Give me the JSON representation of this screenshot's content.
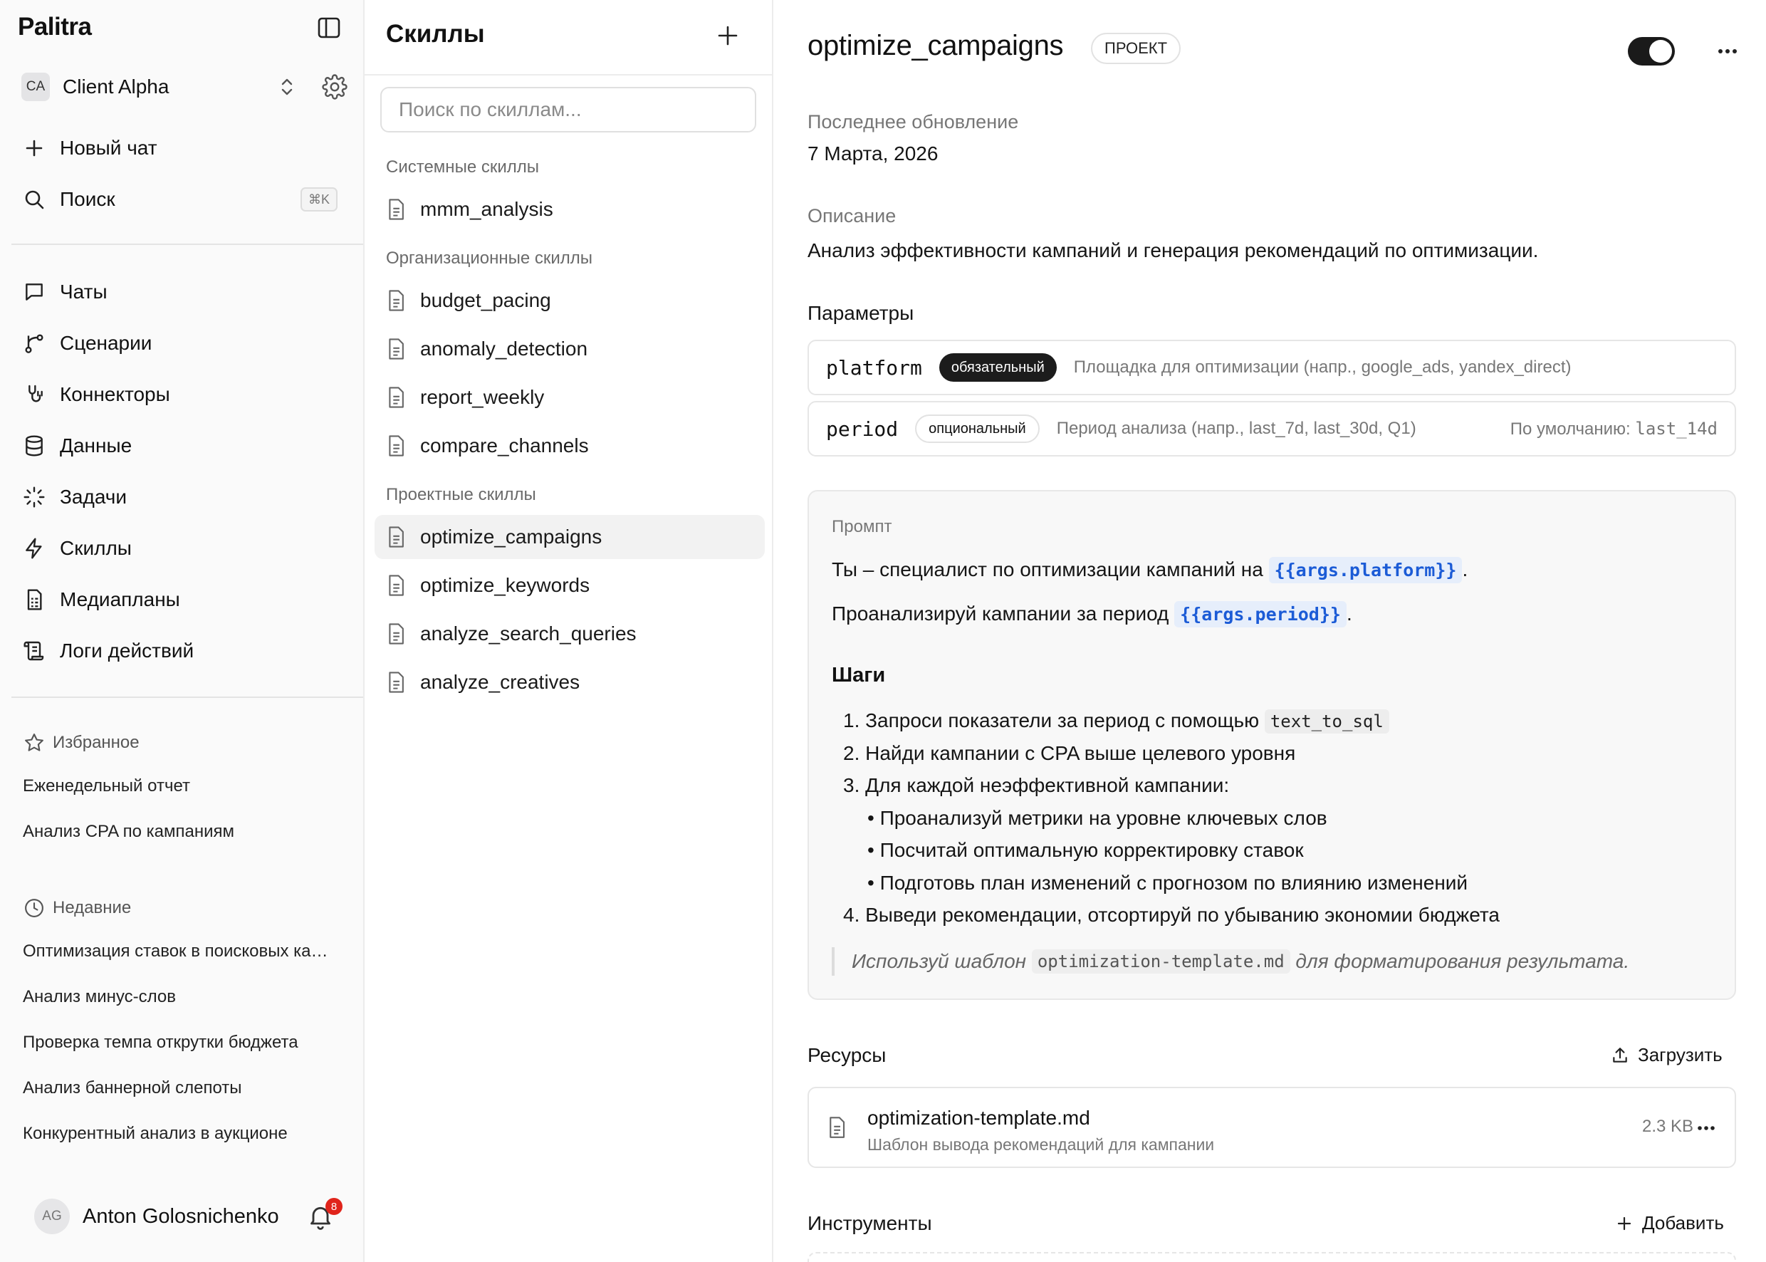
{
  "sidebar": {
    "brand": "Palitra",
    "org": {
      "initials": "CA",
      "name": "Client Alpha"
    },
    "new_chat": "Новый чат",
    "search": {
      "label": "Поиск",
      "shortcut": "⌘K"
    },
    "nav": [
      {
        "label": "Чаты",
        "icon": "chat-icon"
      },
      {
        "label": "Сценарии",
        "icon": "branch-icon"
      },
      {
        "label": "Коннекторы",
        "icon": "connector-icon"
      },
      {
        "label": "Данные",
        "icon": "database-icon"
      },
      {
        "label": "Задачи",
        "icon": "loader-icon"
      },
      {
        "label": "Скиллы",
        "icon": "lightning-icon"
      },
      {
        "label": "Медиапланы",
        "icon": "sheet-icon"
      },
      {
        "label": "Логи действий",
        "icon": "scroll-icon"
      }
    ],
    "favorites": {
      "title": "Избранное",
      "items": [
        "Еженедельный отчет",
        "Анализ CPA по кампаниям"
      ]
    },
    "recent": {
      "title": "Недавние",
      "items": [
        "Оптимизация ставок в поисковых кампаниях",
        "Анализ минус-слов",
        "Проверка темпа открутки бюджета",
        "Анализ баннерной слепоты",
        "Конкурентный анализ в аукционе"
      ]
    },
    "user": {
      "initials": "AG",
      "name": "Anton Golosnichenko",
      "notifications": "8"
    }
  },
  "skills": {
    "title": "Скиллы",
    "search_placeholder": "Поиск по скиллам...",
    "groups": [
      {
        "label": "Системные скиллы",
        "items": [
          "mmm_analysis"
        ]
      },
      {
        "label": "Организационные скиллы",
        "items": [
          "budget_pacing",
          "anomaly_detection",
          "report_weekly",
          "compare_channels"
        ]
      },
      {
        "label": "Проектные скиллы",
        "items": [
          "optimize_campaigns",
          "optimize_keywords",
          "analyze_search_queries",
          "analyze_creatives"
        ]
      }
    ],
    "active": "optimize_campaigns"
  },
  "detail": {
    "title": "optimize_campaigns",
    "badge": "ПРОЕКТ",
    "enabled": true,
    "updated_label": "Последнее обновление",
    "updated_value": "7 Марта, 2026",
    "description_label": "Описание",
    "description_value": "Анализ эффективности кампаний и генерация рекомендаций по оптимизации.",
    "params_title": "Параметры",
    "params": [
      {
        "name": "platform",
        "kind": "обязательный",
        "desc": "Площадка для оптимизации (напр., google_ads, yandex_direct)"
      },
      {
        "name": "period",
        "kind": "опциональный",
        "desc": "Период анализа (напр., last_7d, last_30d, Q1)",
        "default_label": "По умолчанию:",
        "default_value": "last_14d"
      }
    ],
    "prompt": {
      "label": "Промпт",
      "line1_text": "Ты – специалист по оптимизации кампаний на",
      "line1_var": "{{args.platform}}",
      "line2_text": "Проанализируй кампании за период",
      "line2_var": "{{args.period}}",
      "dot": ".",
      "steps_title": "Шаги",
      "step1_text": "1. Запроси показатели за период с помощью",
      "step1_code": "text_to_sql",
      "step2": "2. Найди кампании с CPA выше целевого уровня",
      "step3": "3. Для каждой неэффективной кампании:",
      "sub": [
        "Проанализуй метрики на уровне ключевых слов",
        "Посчитай оптимальную корректировку ставок",
        "Подготовь план изменений с прогнозом по влиянию изменений"
      ],
      "step4": "4. Выведи рекомендации, отсортируй по убыванию экономии бюджета",
      "quote_before": "Используй шаблон",
      "quote_code": "optimization-template.md",
      "quote_after": "для форматирования результата."
    },
    "resources": {
      "title": "Ресурсы",
      "upload": "Загрузить",
      "file": {
        "name": "optimization-template.md",
        "desc": "Шаблон вывода рекомендаций для кампании",
        "size": "2.3 KB"
      }
    },
    "tools": {
      "title": "Инструменты",
      "add": "Добавить"
    }
  }
}
